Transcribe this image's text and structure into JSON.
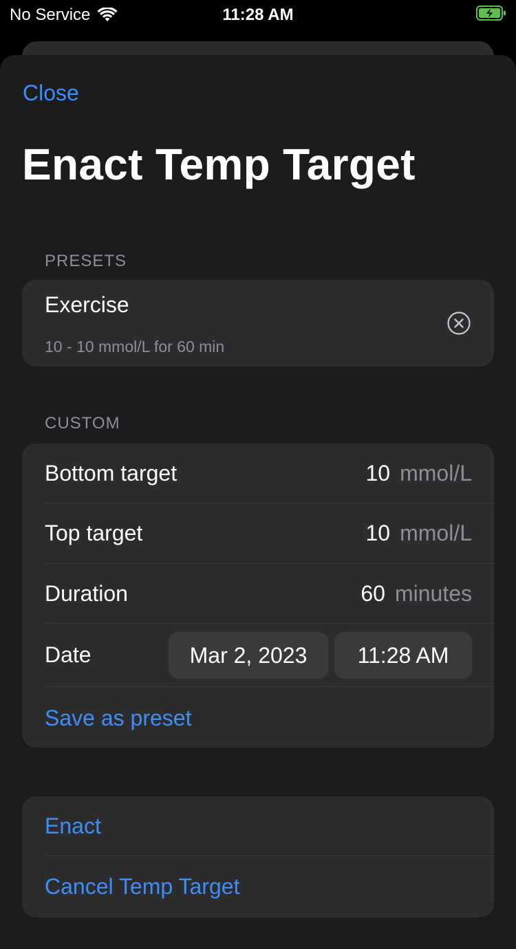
{
  "status_bar": {
    "carrier": "No Service",
    "time": "11:28 AM"
  },
  "nav": {
    "close_label": "Close"
  },
  "title": "Enact Temp Target",
  "presets": {
    "header": "PRESETS",
    "items": [
      {
        "name": "Exercise",
        "detail": "10 - 10 mmol/L for 60 min"
      }
    ]
  },
  "custom": {
    "header": "CUSTOM",
    "bottom_target": {
      "label": "Bottom target",
      "value": "10",
      "unit": "mmol/L"
    },
    "top_target": {
      "label": "Top target",
      "value": "10",
      "unit": "mmol/L"
    },
    "duration": {
      "label": "Duration",
      "value": "60",
      "unit": "minutes"
    },
    "date": {
      "label": "Date",
      "date_value": "Mar 2, 2023",
      "time_value": "11:28 AM"
    },
    "save_preset_label": "Save as preset"
  },
  "actions": {
    "enact_label": "Enact",
    "cancel_label": "Cancel Temp Target"
  },
  "colors": {
    "accent": "#3e8ef7",
    "background": "#1c1c1e",
    "group": "#2c2c2e"
  }
}
